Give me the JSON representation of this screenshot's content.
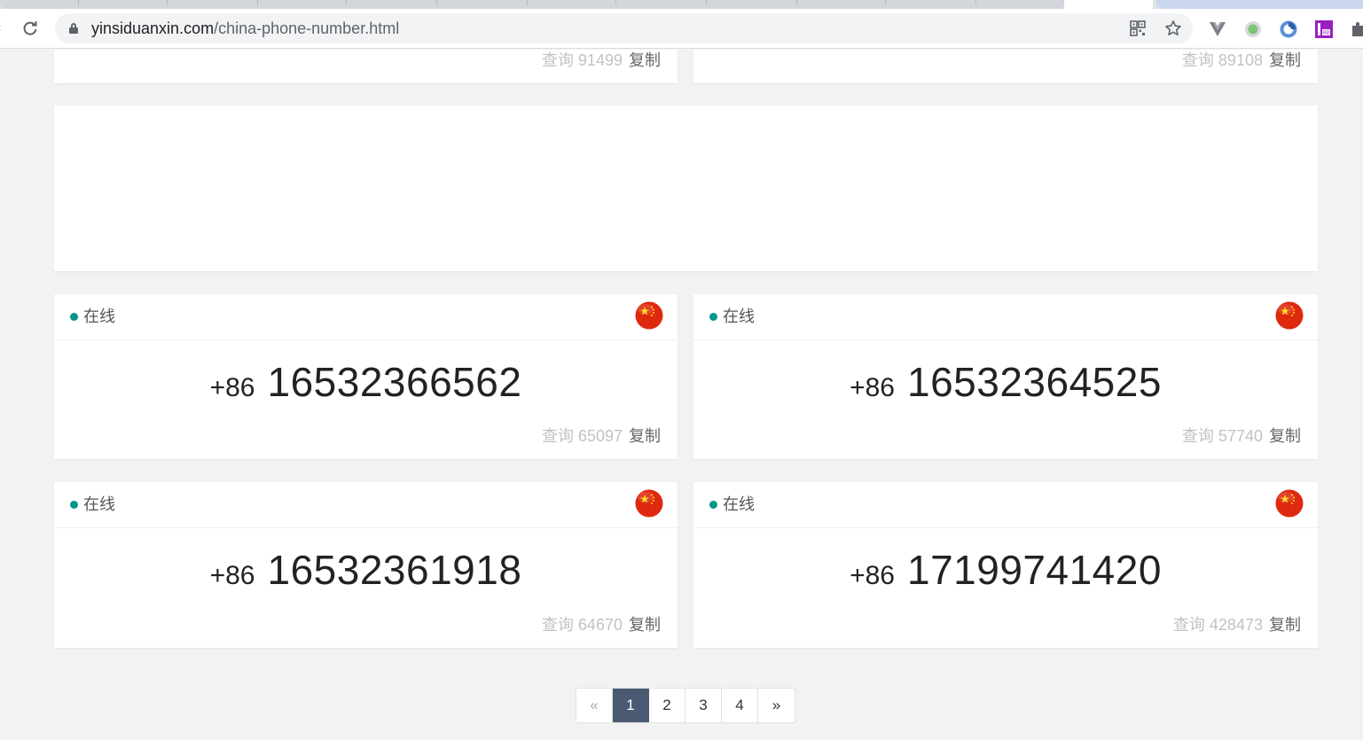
{
  "browser": {
    "url_host": "yinsiduanxin.com",
    "url_path": "/china-phone-number.html"
  },
  "top_cards": [
    {
      "query_label": "查询",
      "query_count": "91499",
      "copy_label": "复制"
    },
    {
      "query_label": "查询",
      "query_count": "89108",
      "copy_label": "复制"
    }
  ],
  "phone_cards": [
    {
      "status": "在线",
      "country_code": "+86",
      "number": "16532366562",
      "query_label": "查询",
      "query_count": "65097",
      "copy_label": "复制"
    },
    {
      "status": "在线",
      "country_code": "+86",
      "number": "16532364525",
      "query_label": "查询",
      "query_count": "57740",
      "copy_label": "复制"
    },
    {
      "status": "在线",
      "country_code": "+86",
      "number": "16532361918",
      "query_label": "查询",
      "query_count": "64670",
      "copy_label": "复制"
    },
    {
      "status": "在线",
      "country_code": "+86",
      "number": "17199741420",
      "query_label": "查询",
      "query_count": "428473",
      "copy_label": "复制"
    }
  ],
  "pagination": {
    "prev": "«",
    "pages": [
      "1",
      "2",
      "3",
      "4"
    ],
    "current": "1",
    "next": "»"
  },
  "colors": {
    "status_dot": "#009688",
    "active_page": "#4b5a73",
    "flag_red": "#de2910",
    "flag_star": "#ffde00"
  },
  "icons": {
    "flag": "china-flag-icon",
    "reload": "reload-icon",
    "lock": "lock-icon"
  }
}
